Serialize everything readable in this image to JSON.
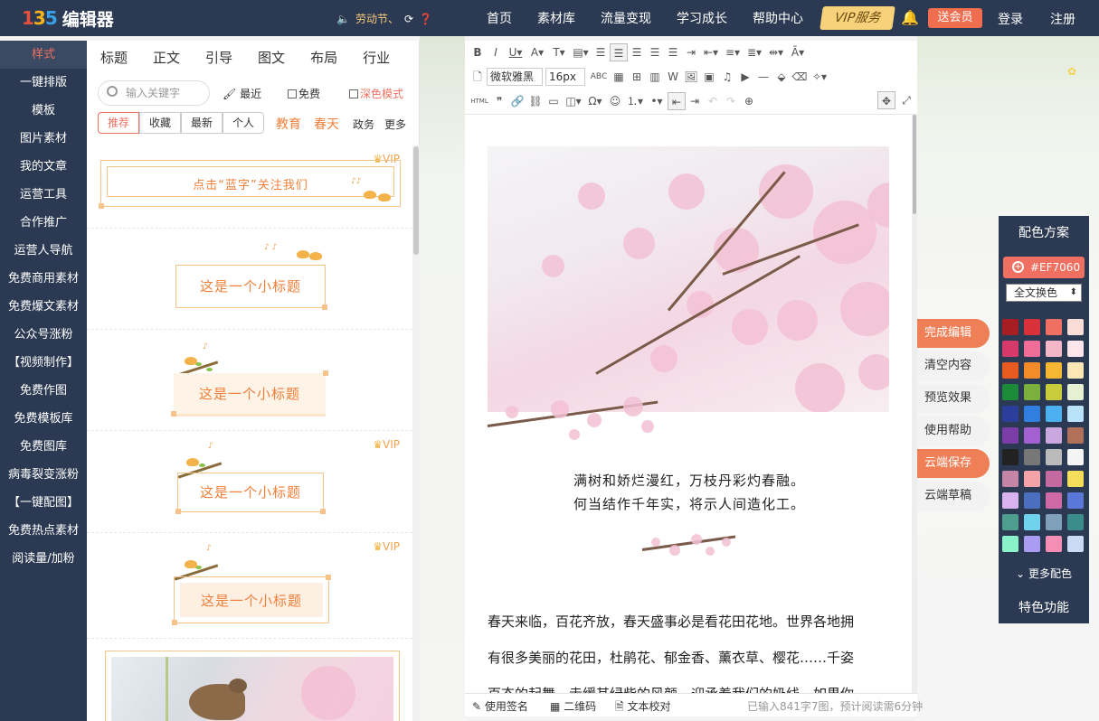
{
  "topbar": {
    "logo_mark": [
      "1",
      "3",
      "5"
    ],
    "logo_text": "编辑器",
    "notice": "劳动节、",
    "nav": [
      "首页",
      "素材库",
      "流量变现",
      "学习成长",
      "帮助中心"
    ],
    "vip": "VIP服务",
    "give_member": "送会员",
    "login": "登录",
    "register": "注册"
  },
  "sidebar": [
    "样式",
    "一键排版",
    "模板",
    "图片素材",
    "我的文章",
    "运营工具",
    "合作推广",
    "运营人导航",
    "免费商用素材",
    "免费爆文素材",
    "公众号涨粉",
    "【视频制作】",
    "免费作图",
    "免费模板库",
    "免费图库",
    "病毒裂变涨粉",
    "【一键配图】",
    "免费热点素材",
    "阅读量/加粉"
  ],
  "panel": {
    "categories": [
      "标题",
      "正文",
      "引导",
      "图文",
      "布局",
      "行业"
    ],
    "search_placeholder": "输入关键字",
    "recent": "最近",
    "free": "免费",
    "dark_mode": "深色模式",
    "filters": [
      "推荐",
      "收藏",
      "最新",
      "个人"
    ],
    "tags": [
      "教育",
      "春天"
    ],
    "tags_gray": [
      "政务",
      "更多"
    ],
    "vip_label": "VIP",
    "templates": [
      {
        "text": "点击“蓝字”关注我们",
        "vip": true
      },
      {
        "text": "这是一个小标题",
        "vip": false
      },
      {
        "text": "这是一个小标题",
        "vip": false
      },
      {
        "text": "这是一个小标题",
        "vip": true
      },
      {
        "text": "这是一个小标题",
        "vip": true
      }
    ]
  },
  "toolbar": {
    "font_family": "微软雅黑",
    "font_size": "16px",
    "html_label": "HTML",
    "abc_label": "ABC"
  },
  "editor": {
    "poem_line1": "满树和娇烂漫红，万枝丹彩灼春融。",
    "poem_line2": "何当结作千年实，将示人间造化工。",
    "para_line1": "春天来临，百花齐放，春天盛事必是看花田花地。世界各地拥",
    "para_line2": "有很多美丽的花田，杜鹃花、郁金香、薰衣草、樱花……千姿",
    "para_line3": "百态的起舞，走缓其绿柴的风颜，迎承着我们的奶线。如果你"
  },
  "statusbar": {
    "signature": "使用签名",
    "qrcode": "二维码",
    "proofread": "文本校对",
    "count": "已输入841字7图，预计阅读需6分钟"
  },
  "actions": [
    "完成编辑",
    "清空内容",
    "预览效果",
    "使用帮助",
    "云端保存",
    "云端草稿"
  ],
  "color_panel": {
    "title": "配色方案",
    "hex": "#EF7060",
    "select": "全文换色",
    "more": "更多配色",
    "special": "特色功能",
    "colors": [
      "#a61e22",
      "#d8313a",
      "#ef7060",
      "#fadcd6",
      "#d63a6b",
      "#ef6d96",
      "#f5b6c8",
      "#fce6ec",
      "#e85b20",
      "#f48b2a",
      "#f7b632",
      "#fbe7b4",
      "#1d8a3a",
      "#7ab03b",
      "#c8cc3a",
      "#e6f0d3",
      "#2b3e9c",
      "#2f7ee0",
      "#4bb0f0",
      "#b9e1f8",
      "#7b3ea8",
      "#a260d0",
      "#cba7e0",
      "#b0705a",
      "#222222",
      "#777777",
      "#bbbbbb",
      "#f4f4f4",
      "#c484a6",
      "#f4a4a8",
      "#c46aa0",
      "#f3dd5a",
      "#d9b3f0",
      "#4b6fbf",
      "#d06aa6",
      "#5b78d8",
      "#4d9e8e",
      "#6fd3ee",
      "#7fa0b8",
      "#3a8d8a",
      "#8af2c8",
      "#a99cf2",
      "#f58eb4",
      "#cbdaf4"
    ]
  }
}
